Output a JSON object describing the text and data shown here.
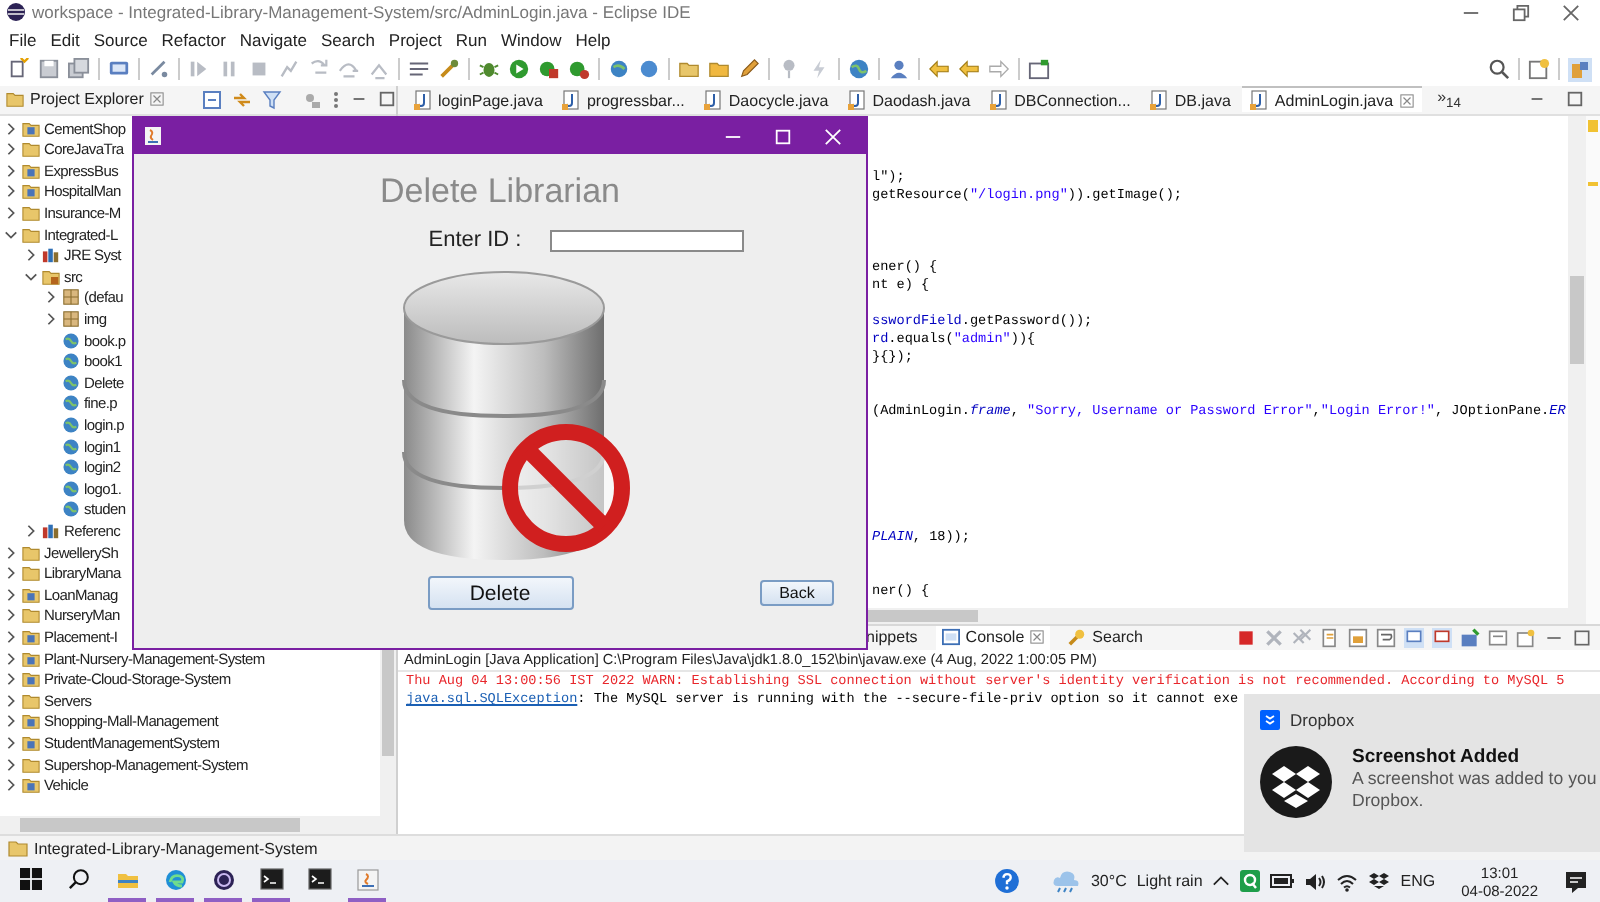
{
  "window": {
    "title": "workspace - Integrated-Library-Management-System/src/AdminLogin.java - Eclipse IDE"
  },
  "menu": [
    "File",
    "Edit",
    "Source",
    "Refactor",
    "Navigate",
    "Search",
    "Project",
    "Run",
    "Window",
    "Help"
  ],
  "project_explorer": {
    "title": "Project Explorer",
    "tree": [
      {
        "label": "CementShop",
        "kind": "project",
        "expanded": false
      },
      {
        "label": "CoreJavaTra",
        "kind": "folder",
        "expanded": false
      },
      {
        "label": "ExpressBus",
        "kind": "project",
        "expanded": false
      },
      {
        "label": "HospitalMan",
        "kind": "project",
        "expanded": false
      },
      {
        "label": "Insurance-M",
        "kind": "folder",
        "expanded": false
      },
      {
        "label": "Integrated-L",
        "kind": "folder",
        "expanded": true,
        "children": [
          {
            "label": "JRE Syst",
            "kind": "library",
            "expanded": false
          },
          {
            "label": "src",
            "kind": "source",
            "expanded": true,
            "children": [
              {
                "label": "(defau",
                "kind": "package",
                "expanded": false
              },
              {
                "label": "img",
                "kind": "package",
                "expanded": false
              },
              {
                "label": "book.p",
                "kind": "file"
              },
              {
                "label": "book1",
                "kind": "file"
              },
              {
                "label": "Delete",
                "kind": "file"
              },
              {
                "label": "fine.p",
                "kind": "file"
              },
              {
                "label": "login.p",
                "kind": "file"
              },
              {
                "label": "login1",
                "kind": "file"
              },
              {
                "label": "login2",
                "kind": "file"
              },
              {
                "label": "logo1.",
                "kind": "file"
              },
              {
                "label": "studen",
                "kind": "file"
              }
            ]
          },
          {
            "label": "Referenc",
            "kind": "library",
            "expanded": false
          }
        ]
      },
      {
        "label": "JewellerySh",
        "kind": "folder",
        "expanded": false
      },
      {
        "label": "LibraryMana",
        "kind": "folder",
        "expanded": false
      },
      {
        "label": "LoanManag",
        "kind": "project",
        "expanded": false
      },
      {
        "label": "NurseryMan",
        "kind": "folder",
        "expanded": false
      },
      {
        "label": "Placement-I",
        "kind": "project",
        "expanded": false
      },
      {
        "label": "Plant-Nursery-Management-System",
        "kind": "project",
        "expanded": false
      },
      {
        "label": "Private-Cloud-Storage-System",
        "kind": "project",
        "expanded": false
      },
      {
        "label": "Servers",
        "kind": "folder",
        "expanded": false
      },
      {
        "label": "Shopping-Mall-Management",
        "kind": "project",
        "expanded": false
      },
      {
        "label": "StudentManagementSystem",
        "kind": "project",
        "expanded": false
      },
      {
        "label": "Supershop-Management-System",
        "kind": "folder",
        "expanded": false
      },
      {
        "label": "Vehicle",
        "kind": "project",
        "expanded": false
      }
    ]
  },
  "editor_tabs": [
    {
      "label": "loginPage.java",
      "selected": false
    },
    {
      "label": "progressbar...",
      "selected": false
    },
    {
      "label": "Daocycle.java",
      "selected": false
    },
    {
      "label": "Daodash.java",
      "selected": false
    },
    {
      "label": "DBConnection...",
      "selected": false
    },
    {
      "label": "DB.java",
      "selected": false
    },
    {
      "label": "AdminLogin.java",
      "selected": true
    }
  ],
  "hidden_tabs": "»$_{14}$",
  "code_lines": [
    {
      "segments": [
        {
          "kind": "code",
          "text": "l\");"
        }
      ]
    },
    {
      "segments": [
        {
          "kind": "code",
          "text": "getResource("
        },
        {
          "kind": "string",
          "text": "\"/login.png\""
        },
        {
          "kind": "code",
          "text": ")).getImage();"
        }
      ]
    },
    {
      "segments": [
        {
          "kind": "code",
          "text": "ener() {"
        }
      ]
    },
    {
      "segments": [
        {
          "kind": "code",
          "text": "nt e) {"
        }
      ]
    },
    {
      "segments": [
        {
          "kind": "field",
          "text": "sswordField"
        },
        {
          "kind": "code",
          "text": ".getPassword());"
        }
      ]
    },
    {
      "segments": [
        {
          "kind": "field",
          "text": "rd"
        },
        {
          "kind": "code",
          "text": ".equals("
        },
        {
          "kind": "string",
          "text": "\"admin\""
        },
        {
          "kind": "code",
          "text": ")){"
        }
      ]
    },
    {
      "segments": [
        {
          "kind": "code",
          "text": "}{});"
        }
      ]
    },
    {
      "segments": [
        {
          "kind": "code",
          "text": "(AdminLogin."
        },
        {
          "kind": "static",
          "text": "frame"
        },
        {
          "kind": "code",
          "text": ", "
        },
        {
          "kind": "string",
          "text": "\"Sorry, Username or Password Error\""
        },
        {
          "kind": "code",
          "text": ","
        },
        {
          "kind": "string",
          "text": "\"Login Error!\""
        },
        {
          "kind": "code",
          "text": ", JOptionPane."
        },
        {
          "kind": "static",
          "text": "ER"
        }
      ]
    },
    {
      "segments": [
        {
          "kind": "static",
          "text": "PLAIN"
        },
        {
          "kind": "code",
          "text": ", 18));"
        }
      ]
    },
    {
      "segments": [
        {
          "kind": "code",
          "text": "ner() {"
        }
      ]
    }
  ],
  "console": {
    "tabs": [
      {
        "label": "nippets",
        "selected": false
      },
      {
        "label": "Console",
        "selected": true
      },
      {
        "label": "Search",
        "selected": false
      }
    ],
    "launch": "AdminLogin [Java Application] C:\\Program Files\\Java\\jdk1.8.0_152\\bin\\javaw.exe  (4 Aug, 2022 1:00:05 PM)",
    "output": [
      {
        "kind": "error",
        "text": "Thu Aug 04 13:00:56 IST 2022 WARN: Establishing SSL connection without server's identity verification is not recommended. According to MySQL 5"
      },
      {
        "kind": "exception",
        "link": "java.sql.SQLException",
        "text": ": The MySQL server is running with the --secure-file-priv option so it cannot exe"
      }
    ]
  },
  "status_bar": {
    "text": "Integrated-Library-Management-System"
  },
  "dialog": {
    "heading": "Delete Librarian",
    "field_label": "Enter ID :",
    "buttons": [
      "Delete",
      "Back"
    ]
  },
  "notification": {
    "app": "Dropbox",
    "title": "Screenshot Added",
    "body_lines": [
      "A screenshot was added to you",
      "Dropbox."
    ]
  },
  "taskbar": {
    "apps": [
      {
        "kind": "files",
        "running": true
      },
      {
        "kind": "browser",
        "running": true
      },
      {
        "kind": "sphere",
        "running": true
      },
      {
        "kind": "terminal",
        "running": true
      },
      {
        "kind": "terminal",
        "running": false
      },
      {
        "kind": "java",
        "running": true
      }
    ],
    "temperature": "30°C",
    "weather": "Light rain",
    "language": "ENG",
    "time": "13:01",
    "date": "04-08-2022"
  }
}
